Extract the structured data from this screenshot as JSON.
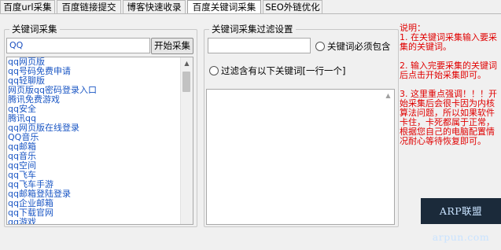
{
  "tabs": [
    {
      "label": "百度url采集"
    },
    {
      "label": "百度链接提交"
    },
    {
      "label": "博客快速收录"
    },
    {
      "label": "百度关键词采集",
      "active": true
    },
    {
      "label": "SEO外链优化"
    }
  ],
  "keyword_group": {
    "title": "关键词采集",
    "input_value": "QQ",
    "start_button": "开始采集",
    "results": [
      "qq网页版",
      "qq号码免费申请",
      "qq轻聊版",
      "网页版qq密码登录入口",
      "腾讯免费游戏",
      "qq安全",
      "腾讯qq",
      "qq网页版在线登录",
      "QQ音乐",
      "qq邮箱",
      "qq音乐",
      "qq空间",
      "qq飞车",
      "qq飞车手游",
      "qq邮箱登陆登录",
      "qq企业邮箱",
      "qq下载官网",
      "qq游戏"
    ]
  },
  "filter_group": {
    "title": "关键词采集过滤设置",
    "must_include_value": "",
    "must_include_label": "关键词必须包含",
    "exclude_label": "过滤含有以下关键词[一行一个]",
    "exclude_value": ""
  },
  "note": {
    "text": "说明：\n1. 在关键词采集输入要采集的关键词。\n\n2. 输入完要采集的关键词后点击开始采集即可。\n\n3. 这里重点强调！！！开始采集后会很卡因为内核算法问题，所以如果软件卡住，卡死都属于正常，根据您自己的电脑配置情况耐心等待恢复即可。"
  },
  "watermark": {
    "text": "ARP联盟 arpun.com"
  },
  "colors": {
    "accent_red": "#e00000",
    "link_blue": "#1a56c4"
  }
}
